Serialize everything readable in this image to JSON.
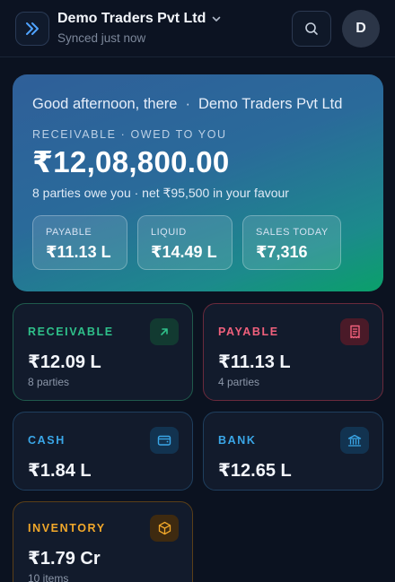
{
  "header": {
    "company_name": "Demo Traders Pvt Ltd",
    "sync_status": "Synced just now",
    "avatar_initial": "D"
  },
  "hero": {
    "greeting": "Good afternoon, there",
    "company": "Demo Traders Pvt Ltd",
    "label": "RECEIVABLE · OWED TO YOU",
    "amount": "₹12,08,800.00",
    "summary": "8 parties owe you · net ₹95,500 in your favour",
    "stats": [
      {
        "label": "PAYABLE",
        "value": "₹11.13 L"
      },
      {
        "label": "LIQUID",
        "value": "₹14.49 L"
      },
      {
        "label": "SALES TODAY",
        "value": "₹7,316"
      }
    ]
  },
  "cards": [
    {
      "label": "RECEIVABLE",
      "value": "₹12.09 L",
      "sub": "8 parties",
      "icon": "arrow-up-right-icon",
      "color": "#2fc08a"
    },
    {
      "label": "PAYABLE",
      "value": "₹11.13 L",
      "sub": "4 parties",
      "icon": "receipt-icon",
      "color": "#f0607c"
    },
    {
      "label": "CASH",
      "value": "₹1.84 L",
      "sub": "",
      "icon": "wallet-icon",
      "color": "#3aa7e8"
    },
    {
      "label": "BANK",
      "value": "₹12.65 L",
      "sub": "",
      "icon": "bank-icon",
      "color": "#3aa7e8"
    },
    {
      "label": "INVENTORY",
      "value": "₹1.79 Cr",
      "sub": "10 items",
      "icon": "box-icon",
      "color": "#f2a82a"
    }
  ]
}
